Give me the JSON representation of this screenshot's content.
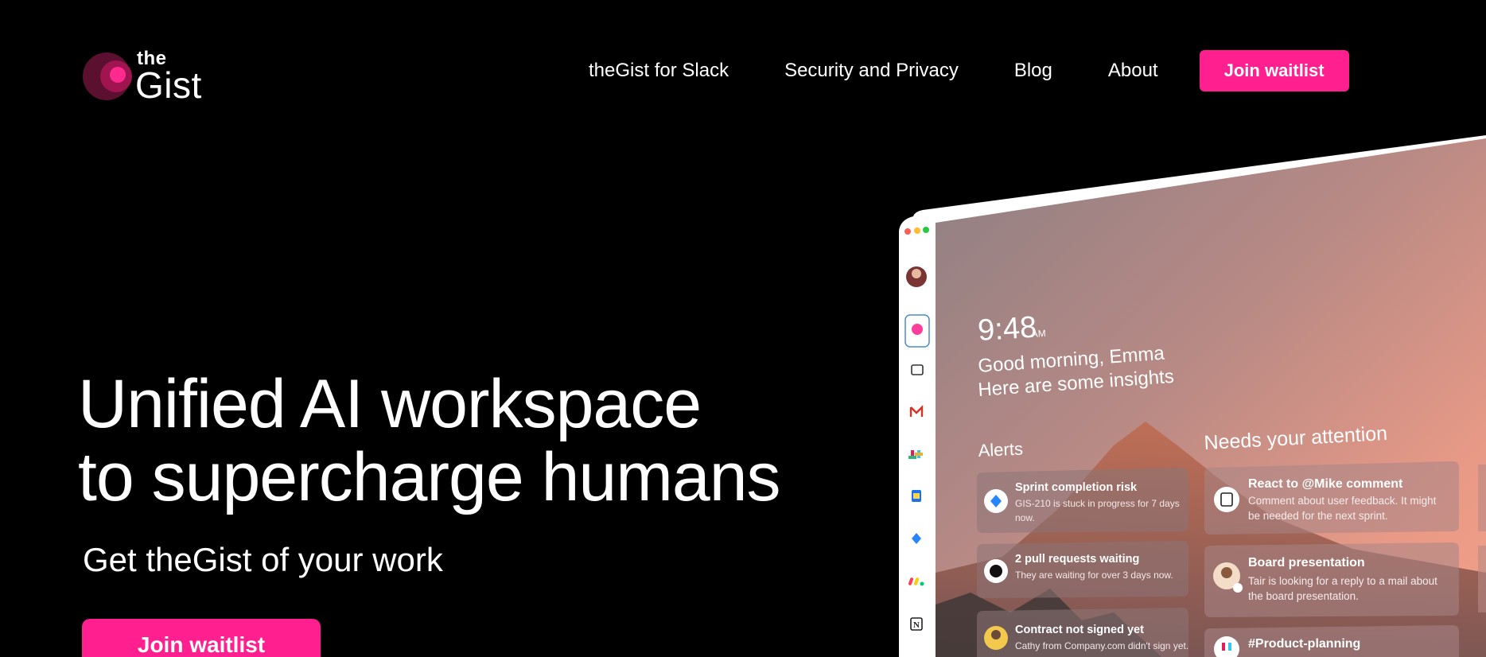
{
  "brand": {
    "logo_the": "the",
    "logo_gist": "Gist",
    "accent": "#ff1f8e"
  },
  "nav": {
    "items": [
      "theGist for Slack",
      "Security and Privacy",
      "Blog",
      "About"
    ],
    "cta": "Join waitlist"
  },
  "hero": {
    "title_line1": "Unified AI workspace",
    "title_line2": "to supercharge humans",
    "subtitle": "Get theGist of your work",
    "cta": "Join waitlist"
  },
  "app": {
    "time": "9:48",
    "ampm": "AM",
    "greeting": "Good morning, Emma",
    "insights": "Here are some insights",
    "alerts_heading": "Alerts",
    "attention_heading": "Needs your attention",
    "alerts": [
      {
        "title": "Sprint completion risk",
        "desc1": "GIS-210 is stuck in progress for 7 days",
        "desc2": "now.",
        "icon": "jira-icon"
      },
      {
        "title": "2 pull requests waiting",
        "desc1": "They are waiting for over 3 days now.",
        "desc2": "",
        "icon": "github-icon"
      },
      {
        "title": "Contract not signed yet",
        "desc1": "Cathy from Company.com didn't sign yet.",
        "desc2": "",
        "icon": "person-avatar"
      }
    ],
    "attention": [
      {
        "title": "React to @Mike comment",
        "desc1": "Comment about user feedback. It might",
        "desc2": "be needed for the next sprint.",
        "icon": "notion-icon"
      },
      {
        "title": "Board presentation",
        "desc1": "Tair is looking for a reply to a mail about",
        "desc2": "the board presentation.",
        "icon": "person-avatar"
      },
      {
        "title": "#Product-planning",
        "desc1": "",
        "desc2": "",
        "icon": "slack-icon"
      }
    ]
  }
}
